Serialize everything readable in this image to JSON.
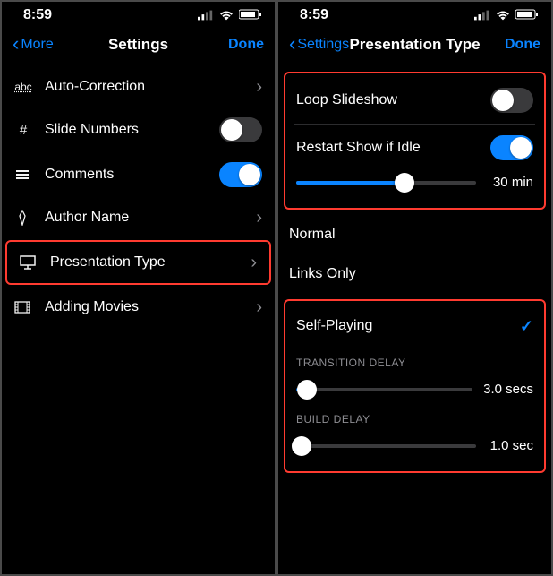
{
  "status": {
    "time": "8:59"
  },
  "left": {
    "nav": {
      "back": "More",
      "title": "Settings",
      "done": "Done"
    },
    "rows": {
      "autocorrect": {
        "label": "Auto-Correction",
        "accessory": "chev"
      },
      "slideNumbers": {
        "label": "Slide Numbers",
        "accessory": "toggle_off"
      },
      "comments": {
        "label": "Comments",
        "accessory": "toggle_on"
      },
      "author": {
        "label": "Author Name",
        "accessory": "chev"
      },
      "presType": {
        "label": "Presentation Type",
        "accessory": "chev"
      },
      "addingMovies": {
        "label": "Adding Movies",
        "accessory": "chev"
      }
    }
  },
  "right": {
    "nav": {
      "back": "Settings",
      "title": "Presentation Type",
      "done": "Done"
    },
    "loop": {
      "label": "Loop Slideshow",
      "on": false
    },
    "restart": {
      "label": "Restart Show if Idle",
      "on": true
    },
    "restartDelay": {
      "value": "30 min",
      "pct": 60
    },
    "types": {
      "normal": "Normal",
      "linksOnly": "Links Only",
      "selfPlaying": "Self-Playing"
    },
    "transition": {
      "label": "TRANSITION DELAY",
      "value": "3.0 secs",
      "pct": 6
    },
    "build": {
      "label": "BUILD DELAY",
      "value": "1.0 sec",
      "pct": 3
    }
  }
}
